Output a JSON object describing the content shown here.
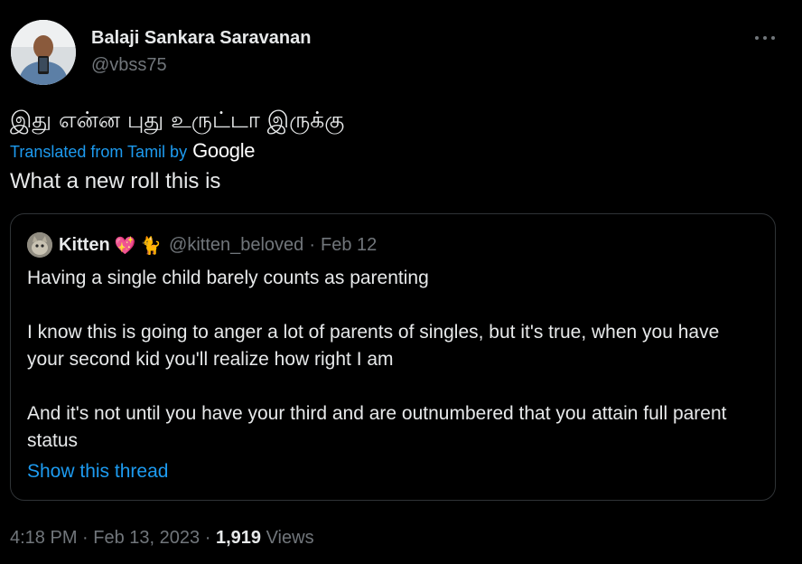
{
  "tweet": {
    "author": {
      "display_name": "Balaji Sankara Saravanan",
      "handle": "@vbss75"
    },
    "more_icon": "more-horizontal-icon",
    "original_text": "இது என்ன புது உருட்டா இருக்கு",
    "translation": {
      "label": "Translated from Tamil by",
      "provider": "Google",
      "text": "What a new roll this is"
    },
    "quote": {
      "author": {
        "display_name": "Kitten",
        "emoji_heart": "💖",
        "emoji_cat": "🐈",
        "handle": "@kitten_beloved"
      },
      "separator": "·",
      "date": "Feb 12",
      "paragraphs": [
        "Having a single child barely counts as parenting",
        "I know this is going to anger a lot of parents of singles, but it's true, when you have your second kid you'll realize how right I am",
        "And it's not until you have your third and are outnumbered that you attain full parent status"
      ],
      "show_thread_label": "Show this thread"
    },
    "meta": {
      "time": "4:18 PM",
      "separator": "·",
      "date": "Feb 13, 2023",
      "views_count": "1,919",
      "views_label": "Views"
    },
    "colors": {
      "background": "#000000",
      "text": "#e7e9ea",
      "secondary": "#71767b",
      "accent": "#1d9bf0",
      "border": "#2f3336"
    }
  }
}
